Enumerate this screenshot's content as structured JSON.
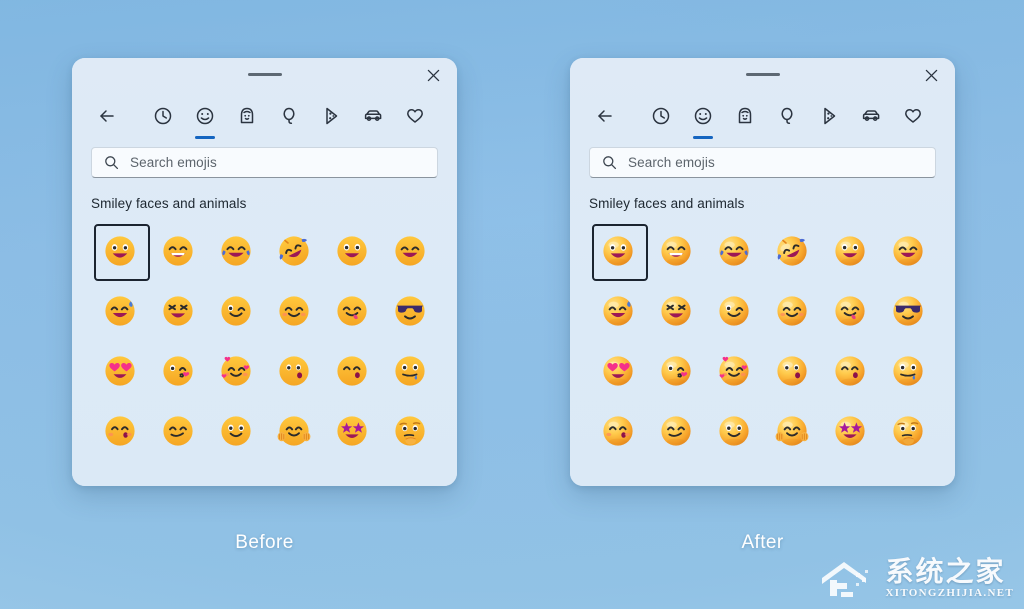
{
  "background": {
    "color_top": "#8fc0e8",
    "color_bottom": "#9ac8e8"
  },
  "panels": [
    {
      "id": "before",
      "caption": "Before",
      "style": "flat",
      "titlebar": {
        "drag_handle": "drag-handle",
        "close_label": "×"
      },
      "nav": {
        "items": [
          {
            "name": "back-arrow",
            "label": "Back",
            "selected": false
          },
          {
            "name": "clock",
            "label": "Recently used",
            "selected": false
          },
          {
            "name": "smiley",
            "label": "Smiley faces and animals",
            "selected": true
          },
          {
            "name": "person",
            "label": "People",
            "selected": false
          },
          {
            "name": "balloon",
            "label": "Celebration and objects",
            "selected": false
          },
          {
            "name": "pizza",
            "label": "Food and plants",
            "selected": false
          },
          {
            "name": "car",
            "label": "Transportation and places",
            "selected": false
          },
          {
            "name": "heart",
            "label": "Symbols",
            "selected": false
          }
        ],
        "accent_color": "#1565c0"
      },
      "search": {
        "placeholder": "Search emojis",
        "value": ""
      },
      "section_title": "Smiley faces and animals",
      "grid": {
        "columns": 6,
        "rows": 4,
        "selected_index": 0,
        "emojis": [
          "grinning-face-big-eyes",
          "beaming-face-smiling-eyes",
          "face-with-tears-of-joy",
          "rolling-on-the-floor-laughing",
          "grinning-face",
          "grinning-squinting-face",
          "grinning-face-with-sweat",
          "squinting-face-with-tongue",
          "winking-face",
          "smiling-face-with-smiling-eyes",
          "face-savoring-food",
          "smiling-face-with-sunglasses",
          "smiling-face-with-heart-eyes",
          "face-blowing-a-kiss",
          "smiling-face-with-hearts",
          "kissing-face",
          "kissing-face-with-closed-eyes",
          "drooling-face",
          "kissing-face-with-smiling-eyes",
          "smirking-face",
          "slightly-smiling-face",
          "hugging-face",
          "star-struck",
          "thinking-face"
        ]
      }
    },
    {
      "id": "after",
      "caption": "After",
      "style": "3d",
      "titlebar": {
        "drag_handle": "drag-handle",
        "close_label": "×"
      },
      "nav": {
        "items": [
          {
            "name": "back-arrow",
            "label": "Back",
            "selected": false
          },
          {
            "name": "clock",
            "label": "Recently used",
            "selected": false
          },
          {
            "name": "smiley",
            "label": "Smiley faces and animals",
            "selected": true
          },
          {
            "name": "person",
            "label": "People",
            "selected": false
          },
          {
            "name": "balloon",
            "label": "Celebration and objects",
            "selected": false
          },
          {
            "name": "pizza",
            "label": "Food and plants",
            "selected": false
          },
          {
            "name": "car",
            "label": "Transportation and places",
            "selected": false
          },
          {
            "name": "heart",
            "label": "Symbols",
            "selected": false
          }
        ],
        "accent_color": "#1565c0"
      },
      "search": {
        "placeholder": "Search emojis",
        "value": ""
      },
      "section_title": "Smiley faces and animals",
      "grid": {
        "columns": 6,
        "rows": 4,
        "selected_index": 0,
        "emojis": [
          "grinning-face-big-eyes",
          "beaming-face-smiling-eyes",
          "face-with-tears-of-joy",
          "rolling-on-the-floor-laughing",
          "grinning-face",
          "grinning-squinting-face",
          "grinning-face-with-sweat",
          "squinting-face-with-tongue",
          "winking-face",
          "smiling-face-with-smiling-eyes",
          "face-savoring-food",
          "smiling-face-with-sunglasses",
          "smiling-face-with-heart-eyes",
          "face-blowing-a-kiss",
          "smiling-face-with-hearts",
          "kissing-face",
          "kissing-face-with-closed-eyes",
          "drooling-face",
          "kissing-face-with-smiling-eyes",
          "smirking-face",
          "slightly-smiling-face",
          "hugging-face",
          "star-struck",
          "thinking-face"
        ]
      }
    }
  ],
  "watermark": {
    "chinese": "系统之家",
    "latin": "XITONGZHIJIA.NET"
  },
  "colors": {
    "panel_bg": "#dfeaf6",
    "emoji_yellow": "#f9a825",
    "emoji_yellow_light": "#ffc83d",
    "mouth_magenta": "#a4154a",
    "accent_blue": "#1565c0",
    "selection_outline": "#1b2430",
    "caption_text": "#ffffff"
  }
}
